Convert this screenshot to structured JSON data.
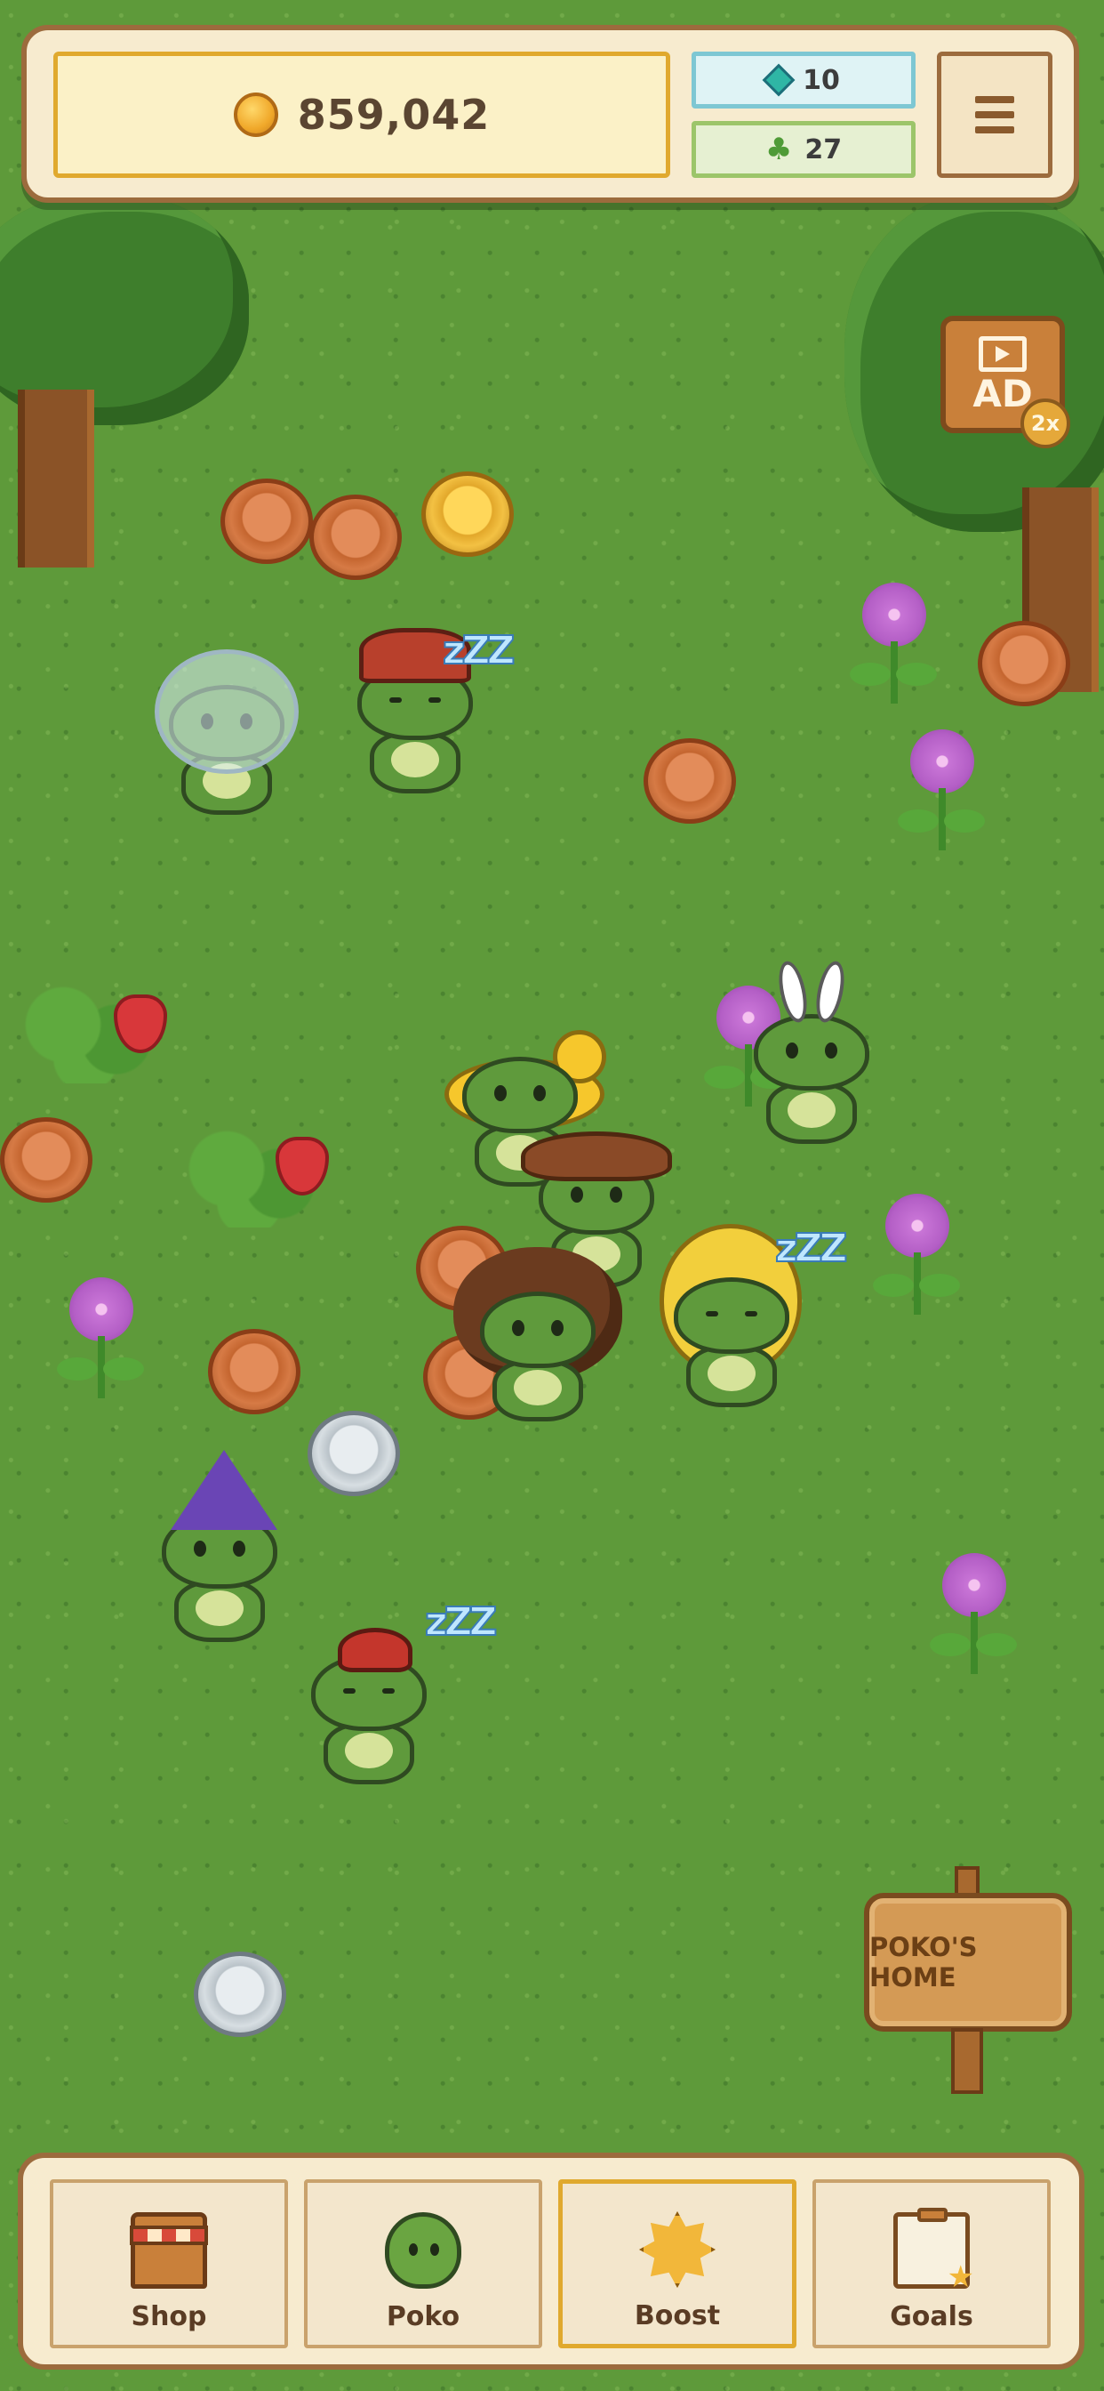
{
  "hud": {
    "coins": "859,042",
    "gems": "10",
    "clovers": "27",
    "menu_icon": "hamburger-menu-icon"
  },
  "ad_reward": {
    "label": "AD",
    "multiplier": "2x"
  },
  "sign": {
    "text": "POKO'S HOME"
  },
  "field": {
    "frogs": [
      {
        "accessory": "space-helmet",
        "state": "awake"
      },
      {
        "accessory": "samurai-helmet",
        "state": "sleeping"
      },
      {
        "accessory": "bunny-ears",
        "state": "awake"
      },
      {
        "accessory": "duck-float",
        "state": "awake"
      },
      {
        "accessory": "cowboy-hat",
        "state": "awake"
      },
      {
        "accessory": "afro",
        "state": "awake"
      },
      {
        "accessory": "banana-hood",
        "state": "sleeping"
      },
      {
        "accessory": "wizard-hat",
        "state": "awake"
      },
      {
        "accessory": "party-hat",
        "state": "sleeping"
      }
    ],
    "sleep_text": "zZZ",
    "coin_types": [
      "copper",
      "gold",
      "silver"
    ]
  },
  "nav": {
    "items": [
      {
        "label": "Shop",
        "icon": "shop-stall-icon"
      },
      {
        "label": "Poko",
        "icon": "frog-face-icon"
      },
      {
        "label": "Boost",
        "icon": "boost-badge-icon",
        "active": true
      },
      {
        "label": "Goals",
        "icon": "clipboard-star-icon"
      }
    ]
  },
  "colors": {
    "grass": "#5e9a3a",
    "panel_bg": "#f7ebcf",
    "panel_border": "#9c6b3d",
    "coin_accent": "#e0a92e",
    "gem_accent": "#7ec7d3",
    "clover_accent": "#9cc56a"
  }
}
